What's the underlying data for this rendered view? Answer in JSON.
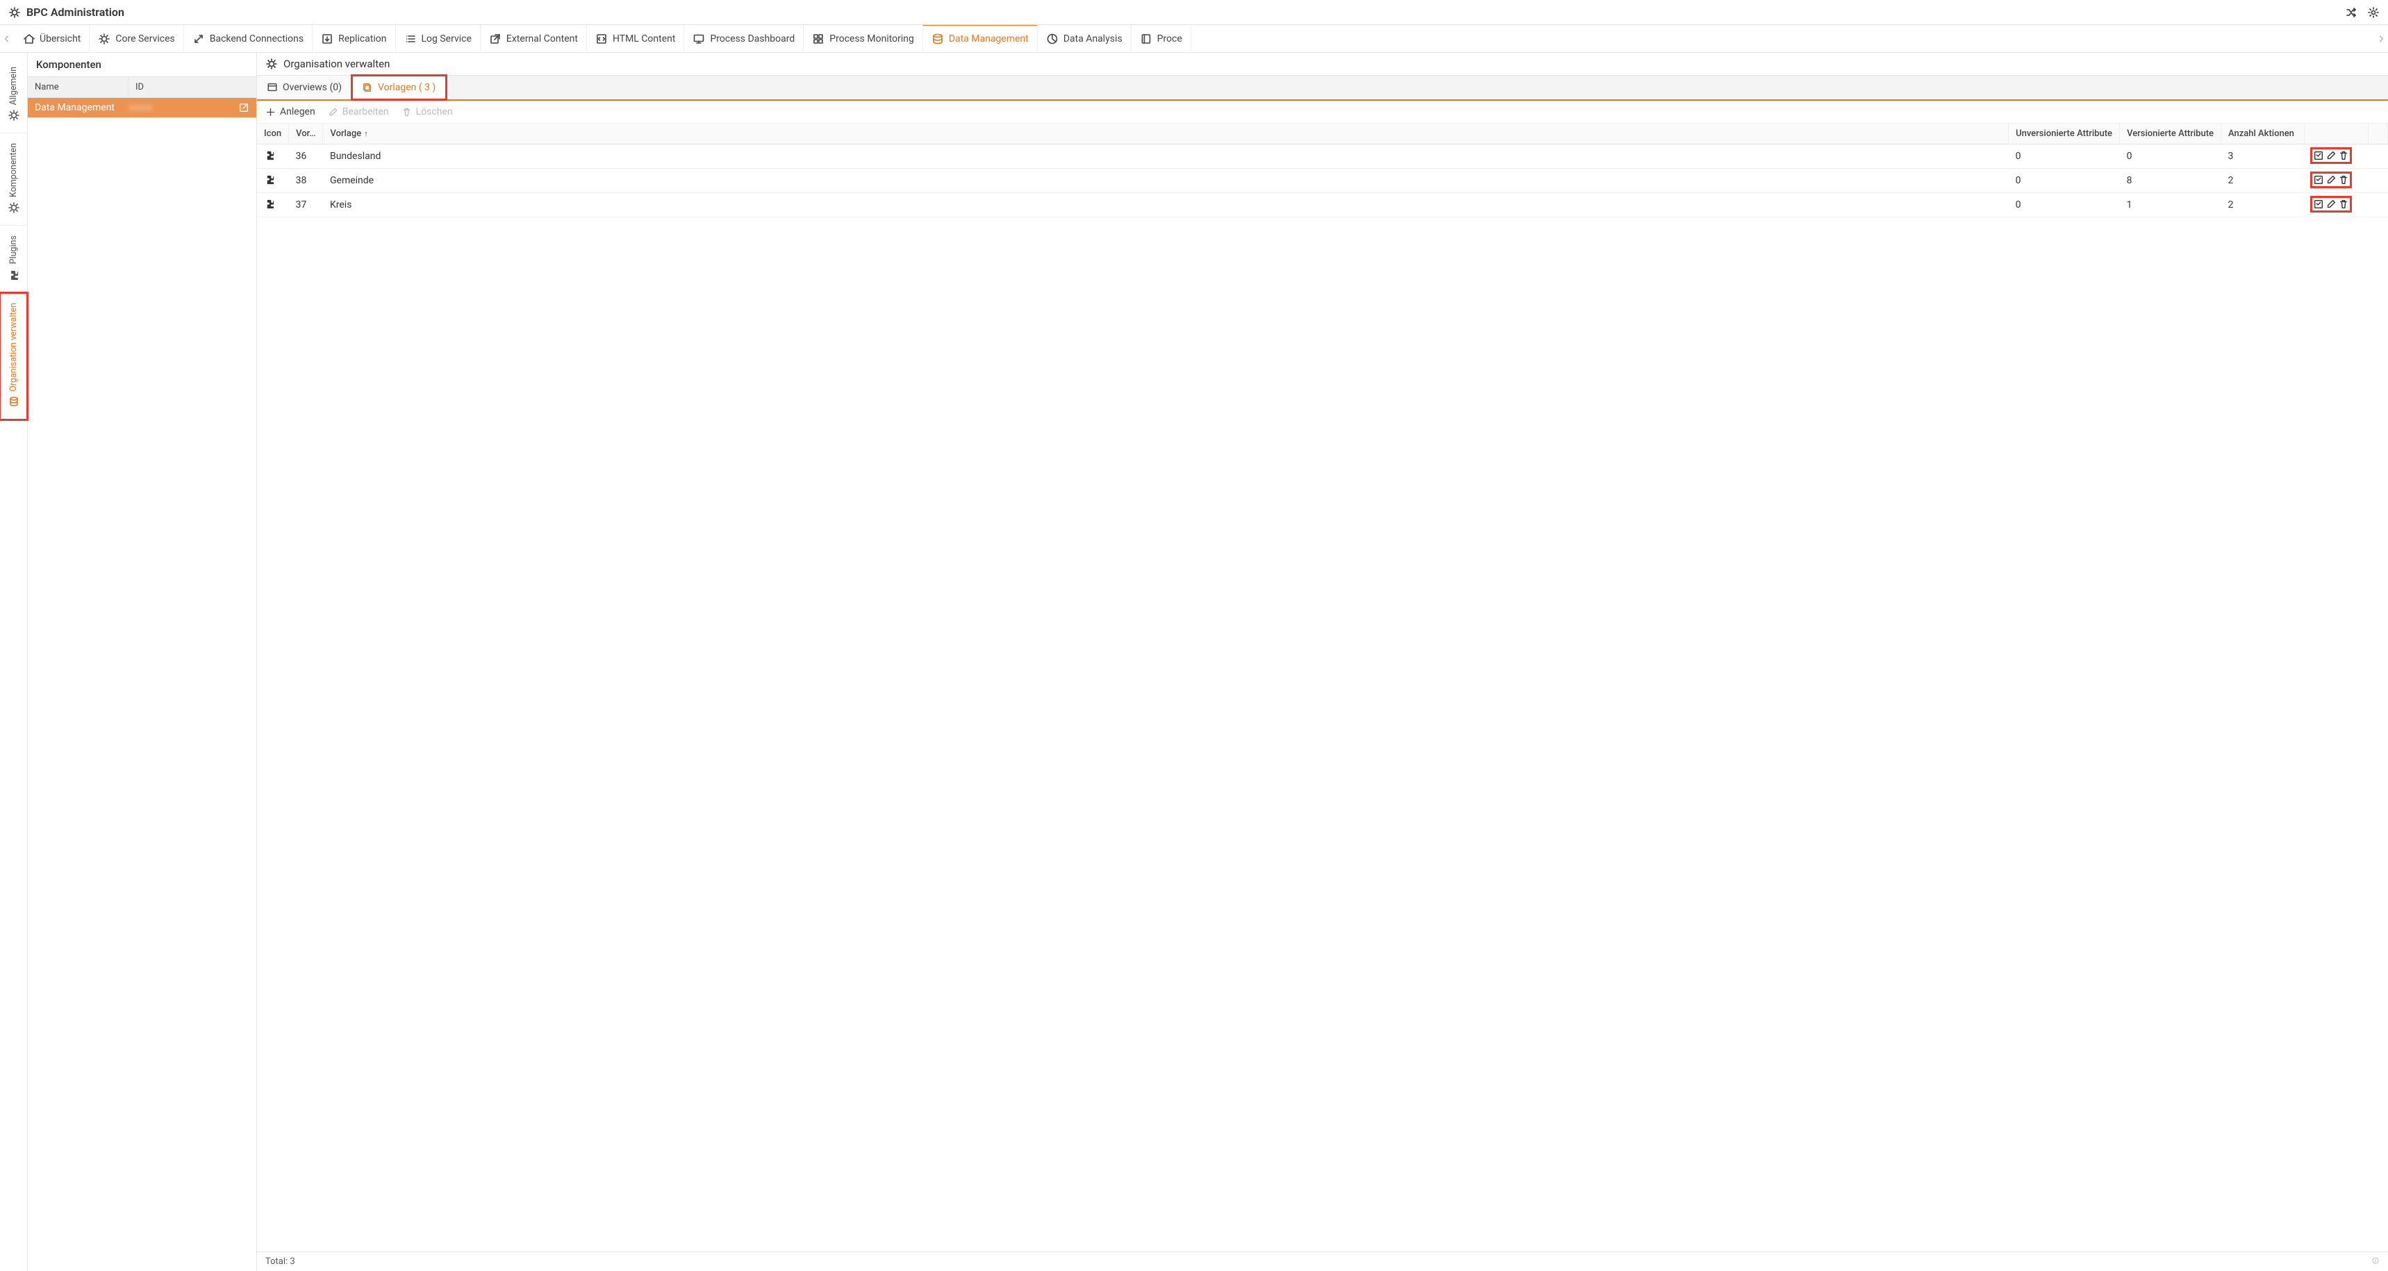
{
  "header": {
    "title": "BPC Administration"
  },
  "toolbar": {
    "tabs": [
      {
        "label": "Übersicht",
        "icon": "home"
      },
      {
        "label": "Core Services",
        "icon": "gears"
      },
      {
        "label": "Backend Connections",
        "icon": "arrows"
      },
      {
        "label": "Replication",
        "icon": "import"
      },
      {
        "label": "Log Service",
        "icon": "list"
      },
      {
        "label": "External Content",
        "icon": "external"
      },
      {
        "label": "HTML Content",
        "icon": "html"
      },
      {
        "label": "Process Dashboard",
        "icon": "monitor"
      },
      {
        "label": "Process Monitoring",
        "icon": "grid4"
      },
      {
        "label": "Data Management",
        "icon": "database"
      },
      {
        "label": "Data Analysis",
        "icon": "piechart"
      },
      {
        "label": "Proce",
        "icon": "book"
      }
    ],
    "active_index": 9
  },
  "vrail": {
    "items": [
      {
        "label": "Allgemein",
        "icon": "gears"
      },
      {
        "label": "Komponenten",
        "icon": "gears"
      },
      {
        "label": "Plugins",
        "icon": "puzzle"
      },
      {
        "label": "Organisation verwalten",
        "icon": "barrel"
      }
    ],
    "active_index": 3
  },
  "components_panel": {
    "title": "Komponenten",
    "cols": {
      "name": "Name",
      "id": "ID"
    },
    "rows": [
      {
        "name": "Data Management",
        "id": "xxxxx"
      }
    ],
    "active_index": 0
  },
  "content": {
    "title": "Organisation verwalten",
    "subtabs": [
      {
        "label": "Overviews (0)"
      },
      {
        "label": "Vorlagen ( 3 )"
      }
    ],
    "active_subtab": 1,
    "actions": {
      "create": "Anlegen",
      "edit": "Bearbeiten",
      "delete": "Löschen"
    },
    "columns": {
      "icon": "Icon",
      "vorid": "Vor…",
      "template": "Vorlage",
      "unversioned": "Unversionierte Attribute",
      "versioned": "Versionierte Attribute",
      "actions_count": "Anzahl Aktionen"
    },
    "rows": [
      {
        "vorid": "36",
        "template": "Bundesland",
        "unversioned": "0",
        "versioned": "0",
        "actions_count": "3"
      },
      {
        "vorid": "38",
        "template": "Gemeinde",
        "unversioned": "0",
        "versioned": "8",
        "actions_count": "2"
      },
      {
        "vorid": "37",
        "template": "Kreis",
        "unversioned": "0",
        "versioned": "1",
        "actions_count": "2"
      }
    ],
    "status": "Total: 3"
  }
}
